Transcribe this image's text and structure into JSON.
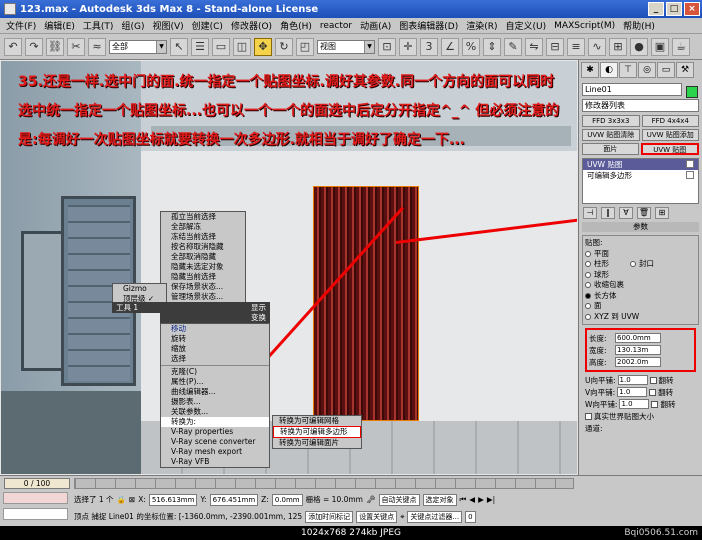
{
  "window": {
    "title": "123.max - Autodesk 3ds Max 8 - Stand-alone License"
  },
  "menubar": [
    "文件(F)",
    "编辑(E)",
    "工具(T)",
    "组(G)",
    "视图(V)",
    "创建(C)",
    "修改器(O)",
    "角色(H)",
    "reactor",
    "动画(A)",
    "图表编辑器(D)",
    "渲染(R)",
    "自定义(U)",
    "MAXScript(M)",
    "帮助(H)"
  ],
  "toolbar": {
    "selection_filter": "全部",
    "view_select": "视图"
  },
  "instruction": "35.还是一样.选中门的面.统一指定一个贴图坐标.调好其参数.同一个方向的面可以同时选中统一指定一个贴图坐标...也可以一个一个的面选中后定分开指定^_^  但必须注意的是:每调好一次贴图坐标就要转换一次多边形.就相当于调好了确定一下...",
  "quad_menu": {
    "display_items": [
      "孤立当前选择",
      "全部解冻",
      "冻结当前选择",
      "按名称取消隐藏",
      "全部取消隐藏",
      "隐藏未选定对象",
      "隐藏当前选择",
      "保存场景状态...",
      "管理场景状态..."
    ],
    "tools_items": [
      "Gizmo",
      "顶层级 ✓"
    ],
    "tools1": "工具 1",
    "display": "显示",
    "transform": "变换",
    "transform_items": [
      "移动",
      "旋转",
      "缩放",
      "选择",
      "克隆(C)",
      "属性(P)...",
      "曲线编辑器...",
      "摄影表...",
      "关联参数...",
      "转换为:",
      "V-Ray properties",
      "V-Ray scene converter",
      "V-Ray mesh export",
      "V-Ray VFB"
    ],
    "submenu": [
      "转换为可编辑网格",
      "转换为可编辑多边形",
      "转换为可编辑面片"
    ]
  },
  "panel": {
    "object_name": "Line01",
    "modifier_list": "修改器列表",
    "buttons": [
      [
        "FFD 3x3x3",
        "FFD 4x4x4"
      ],
      [
        "UVW 贴图清除",
        "UVW 贴图添加"
      ],
      [
        "面片",
        "UVW 贴图"
      ]
    ],
    "stack": [
      "UVW 贴图",
      "可编辑多边形"
    ],
    "rollout_title": "参数",
    "mapping_label": "贴图:",
    "mapping_types": [
      "平面",
      "柱形",
      "球形",
      "收缩包裹",
      "长方体",
      "面",
      "XYZ 到 UVW"
    ],
    "cap_label": "封口",
    "dims": [
      {
        "label": "长度:",
        "value": "600.0mm"
      },
      {
        "label": "宽度:",
        "value": "130.13m"
      },
      {
        "label": "高度:",
        "value": "2002.0m"
      }
    ],
    "tiles": [
      {
        "label": "U向平铺:",
        "value": "1.0"
      },
      {
        "label": "V向平铺:",
        "value": "1.0"
      },
      {
        "label": "W向平铺:",
        "value": "1.0"
      }
    ],
    "flip": "翻转",
    "real_world": "真实世界贴图大小",
    "channel": "通道:"
  },
  "timeline": {
    "frame": "0 / 100"
  },
  "status": {
    "selected": "选择了 1 个",
    "x": "516.613mm",
    "y": "676.451mm",
    "z": "0.0mm",
    "grid": "栅格 = 10.0mm",
    "auto_key": "自动关键点",
    "selected_obj": "选定对象",
    "set_key": "设置关键点",
    "key_filter": "关键点过滤器...",
    "frame_num": "0",
    "prompt": "顶点 捕捉 Line01 的坐标位置: [-1360.0mm, -2390.001mm, 125",
    "add_time": "添加时间标记"
  },
  "caption": "1024x768  274kb  JPEG",
  "watermark": "Bqi0506.51.com"
}
